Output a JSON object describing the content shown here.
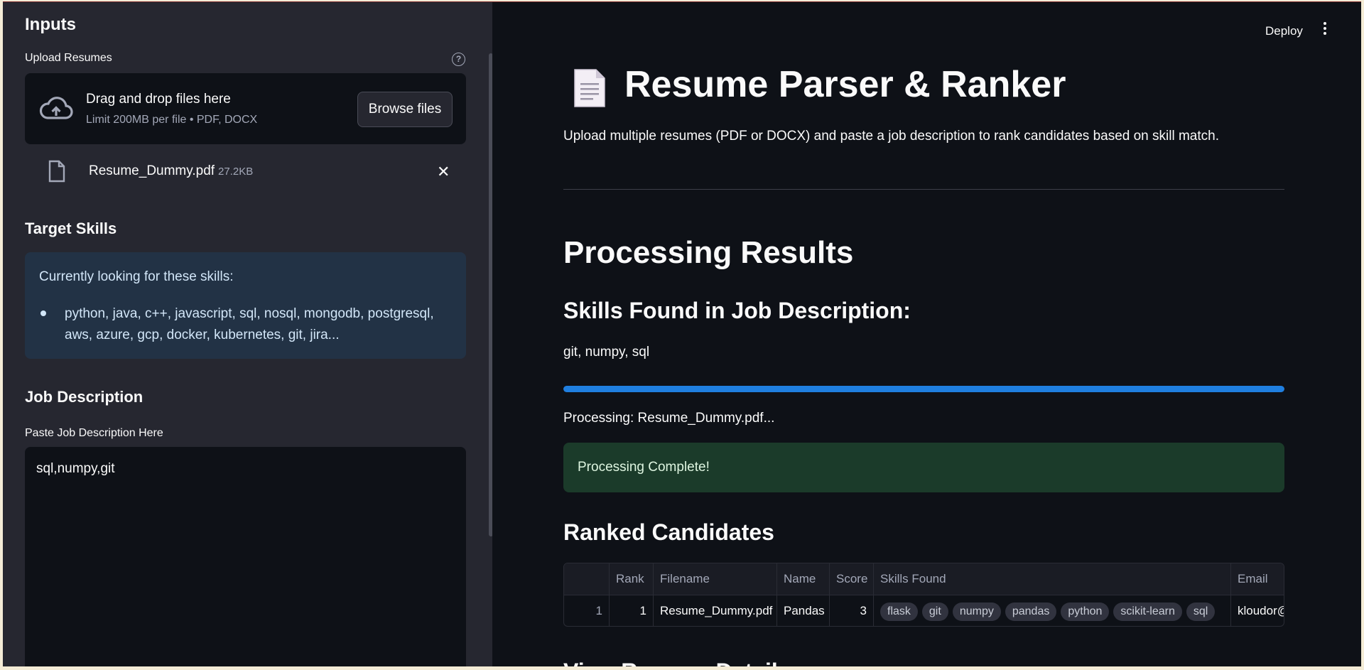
{
  "sidebar": {
    "title": "Inputs",
    "upload": {
      "label": "Upload Resumes",
      "help": "?",
      "drop_main": "Drag and drop files here",
      "drop_sub": "Limit 200MB per file • PDF, DOCX",
      "browse_label": "Browse files"
    },
    "file": {
      "name": "Resume_Dummy.pdf",
      "size": "27.2KB",
      "close": "✕"
    },
    "target": {
      "heading": "Target Skills",
      "intro": "Currently looking for these skills:",
      "skills": "python, java, c++, javascript, sql, nosql, mongodb, postgresql, aws, azure, gcp, docker, kubernetes, git, jira..."
    },
    "job": {
      "heading": "Job Description",
      "label": "Paste Job Description Here",
      "value": "sql,numpy,git"
    }
  },
  "header": {
    "deploy_label": "Deploy"
  },
  "main": {
    "title": "Resume Parser & Ranker",
    "subtitle": "Upload multiple resumes (PDF or DOCX) and paste a job description to rank candidates based on skill match.",
    "results_heading": "Processing Results",
    "skills_heading": "Skills Found in Job Description:",
    "skills_found": "git, numpy, sql",
    "progress": 1.0,
    "processing_text": "Processing: Resume_Dummy.pdf...",
    "success_text": "Processing Complete!",
    "ranked_heading": "Ranked Candidates",
    "table": {
      "headers": [
        "",
        "Rank",
        "Filename",
        "Name",
        "Score",
        "Skills Found",
        "Email"
      ],
      "rows": [
        {
          "index": "1",
          "rank": "1",
          "filename": "Resume_Dummy.pdf",
          "name": "Pandas",
          "score": "3",
          "skills": [
            "flask",
            "git",
            "numpy",
            "pandas",
            "python",
            "scikit-learn",
            "sql"
          ],
          "email": "kloudor@"
        }
      ]
    },
    "next_heading": "View Resume Details"
  },
  "colors": {
    "accent": "#1f7fe0",
    "success_bg": "#1b3b2a",
    "info_bg": "#223245",
    "sidebar_bg": "#262730",
    "main_bg": "#0e1117"
  }
}
